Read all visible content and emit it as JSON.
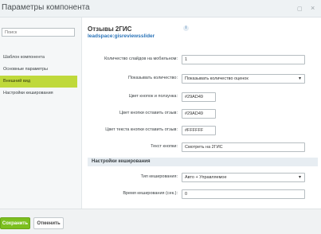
{
  "window": {
    "title": "Параметры компонента",
    "expand_glyph": "▢",
    "close_glyph": "×"
  },
  "sidebar": {
    "search_placeholder": "Поиск",
    "items": [
      {
        "label": "Шаблон компонента"
      },
      {
        "label": "Основные параметры"
      },
      {
        "label": "Внешний вид",
        "active": true
      },
      {
        "label": "Настройки кеширования"
      }
    ]
  },
  "content": {
    "title": "Отзывы 2ГИС",
    "subtitle": "leadspace:gisreviewsslider",
    "info_glyph": "i",
    "fields": {
      "slides_mobile": {
        "label": "Количество слайдов на мобильном:",
        "value": "1"
      },
      "show_count": {
        "label": "Показывать количество:",
        "value": "Показывать количество оценок"
      },
      "btn_slider_color": {
        "label": "Цвет кнопок и ползунка:",
        "value": "#29AD49"
      },
      "leave_btn_color": {
        "label": "Цвет кнопки оставить отзыв:",
        "value": "#29AD49"
      },
      "leave_btn_text_color": {
        "label": "Цвет текста кнопки оставить отзыв:",
        "value": "#FFFFFF"
      },
      "btn_text": {
        "label": "Текст кнопки:",
        "value": "Смотреть на 2ГИС"
      }
    },
    "cache_section": "Настройки кеширования",
    "cache_fields": {
      "cache_type": {
        "label": "Тип кеширования:",
        "value": "Авто + Управляемое"
      },
      "cache_time": {
        "label": "Время кеширования (сек.):",
        "value": "0"
      }
    }
  },
  "footer": {
    "save_label": "Сохранить",
    "cancel_label": "Отменить"
  },
  "colors": {
    "accent": "#7cbf1f",
    "active_nav": "#bfd93b",
    "link": "#2a73b8"
  }
}
